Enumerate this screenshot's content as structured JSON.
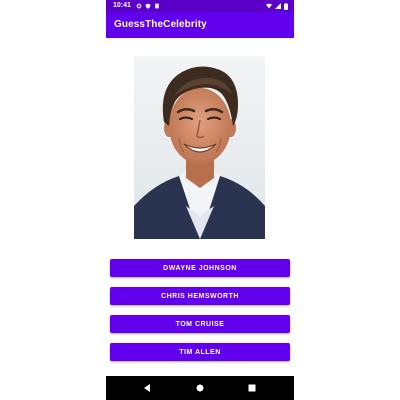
{
  "status_bar": {
    "time": "10:41",
    "left_icons": [
      "gear-icon",
      "shield-icon",
      "sd-card-icon"
    ],
    "right_icons": [
      "wifi-icon",
      "signal-icon",
      "battery-icon"
    ],
    "color": "#5a00c8"
  },
  "app_bar": {
    "title": "GuessTheCelebrity",
    "color": "#6200ee"
  },
  "celebrity_image": {
    "description_icon": "celebrity-photo"
  },
  "answers": [
    {
      "label": "DWAYNE JOHNSON"
    },
    {
      "label": "CHRIS HEMSWORTH"
    },
    {
      "label": "TOM CRUISE"
    },
    {
      "label": "TIM ALLEN"
    }
  ],
  "nav_bar": {
    "buttons": [
      "back-icon",
      "home-icon",
      "recents-icon"
    ]
  },
  "colors": {
    "accent": "#6200ee",
    "status_bar": "#5a00c8",
    "nav_bar": "#000000"
  }
}
